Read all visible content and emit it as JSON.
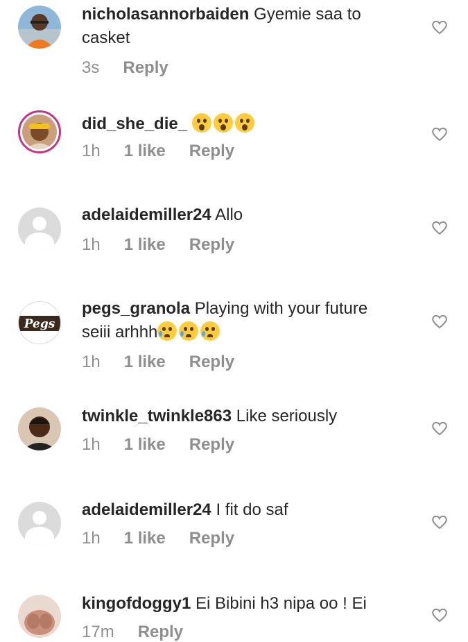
{
  "comments": [
    {
      "username": "nicholasannorbaiden",
      "text": "Gyemie saa to casket",
      "time": "3s",
      "likes": "",
      "reply": "Reply",
      "avatar_icon": "profile-photo-icon"
    },
    {
      "username": "did_she_die_",
      "text": "",
      "time": "1h",
      "likes": "1 like",
      "reply": "Reply",
      "avatar_icon": "profile-photo-icon",
      "emojis": [
        "astonished-face-icon",
        "astonished-face-icon",
        "astonished-face-icon"
      ]
    },
    {
      "username": "adelaidemiller24",
      "text": "Allo",
      "time": "1h",
      "likes": "1 like",
      "reply": "Reply",
      "avatar_icon": "default-avatar-icon"
    },
    {
      "username": "pegs_granola",
      "text": "Playing with your future seiii arhhh",
      "time": "1h",
      "likes": "1 like",
      "reply": "Reply",
      "avatar_icon": "brand-logo-icon",
      "avatar_logo_text": "Pegs",
      "emojis": [
        "crying-face-icon",
        "crying-face-icon",
        "crying-face-icon"
      ]
    },
    {
      "username": "twinkle_twinkle863",
      "text": "Like seriously",
      "time": "1h",
      "likes": "1 like",
      "reply": "Reply",
      "avatar_icon": "profile-photo-icon"
    },
    {
      "username": "adelaidemiller24",
      "text": "I fit do saf",
      "time": "1h",
      "likes": "1 like",
      "reply": "Reply",
      "avatar_icon": "default-avatar-icon"
    },
    {
      "username": "kingofdoggy1",
      "text": "Ei Bibini h3 nipa oo ! Ei",
      "time": "17m",
      "likes": "",
      "reply": "Reply",
      "avatar_icon": "profile-photo-icon"
    }
  ],
  "icons": {
    "like": "heart-outline-icon"
  },
  "colors": {
    "text": "#262626",
    "meta": "#8e8e8e",
    "story_ring": "#c13584"
  }
}
